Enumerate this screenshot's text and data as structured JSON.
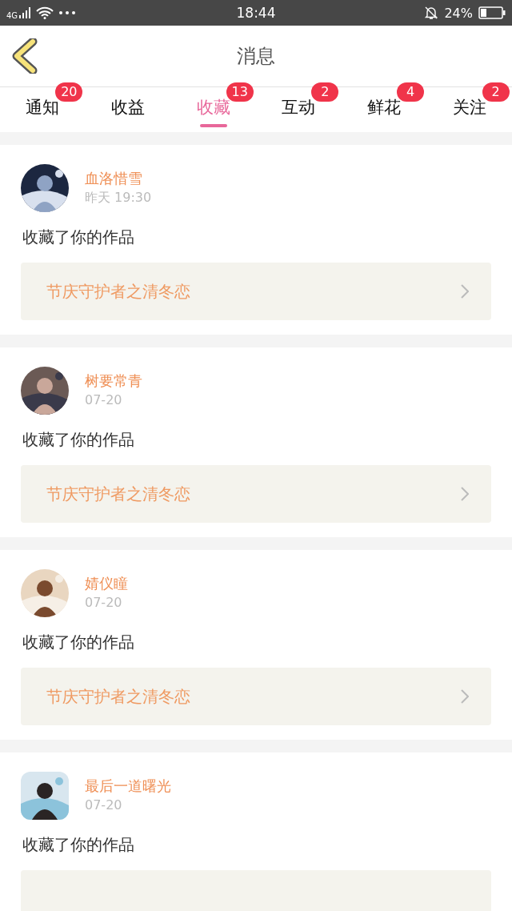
{
  "status_bar": {
    "network": "4G",
    "time": "18:44",
    "battery": "24%"
  },
  "header": {
    "title": "消息"
  },
  "tabs": [
    {
      "label": "通知",
      "badge": "20",
      "selected": false
    },
    {
      "label": "收益",
      "selected": false
    },
    {
      "label": "收藏",
      "badge": "13",
      "selected": true
    },
    {
      "label": "互动",
      "badge": "2",
      "selected": false
    },
    {
      "label": "鲜花",
      "badge": "4",
      "selected": false
    },
    {
      "label": "关注",
      "badge": "2",
      "selected": false
    }
  ],
  "messages": [
    {
      "user": "血洛惜雪",
      "time": "昨天 19:30",
      "avatar_rounded": false,
      "text": "收藏了你的作品",
      "work": "节庆守护者之清冬恋"
    },
    {
      "user": "树要常青",
      "time": "07-20",
      "avatar_rounded": false,
      "text": "收藏了你的作品",
      "work": "节庆守护者之清冬恋"
    },
    {
      "user": "婧仪瞳",
      "time": "07-20",
      "avatar_rounded": false,
      "text": "收藏了你的作品",
      "work": "节庆守护者之清冬恋"
    },
    {
      "user": "最后一道曙光",
      "time": "07-20",
      "avatar_rounded": true,
      "text": "收藏了你的作品"
    }
  ]
}
